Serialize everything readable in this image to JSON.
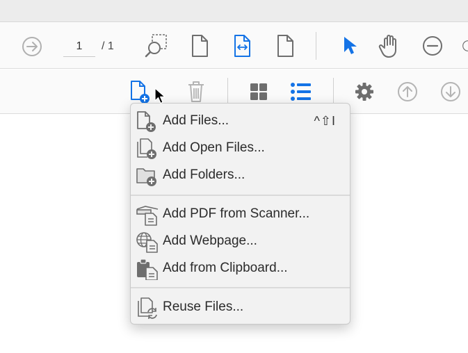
{
  "toolbar_top": {
    "page_current": "1",
    "page_total": "/ 1",
    "icons": [
      "next-page-icon",
      "marquee-zoom-icon",
      "single-page-icon",
      "fit-width-icon",
      "page-icon",
      "select-pointer-icon",
      "hand-icon",
      "zoom-out-icon",
      "zoom-in-icon"
    ]
  },
  "toolbar_secondary": {
    "icons": [
      "add-files-icon",
      "delete-icon",
      "grid-view-icon",
      "list-view-icon",
      "settings-icon",
      "move-up-icon",
      "move-down-icon"
    ]
  },
  "menu": {
    "items": [
      {
        "label": "Add Files...",
        "shortcut": "^⇧I",
        "icon": "add-file-icon"
      },
      {
        "label": "Add Open Files...",
        "icon": "add-open-files-icon"
      },
      {
        "label": "Add Folders...",
        "icon": "add-folder-icon"
      },
      {
        "label": "Add PDF from Scanner...",
        "icon": "scanner-icon"
      },
      {
        "label": "Add Webpage...",
        "icon": "webpage-icon"
      },
      {
        "label": "Add from Clipboard...",
        "icon": "clipboard-icon"
      },
      {
        "label": "Reuse Files...",
        "icon": "reuse-files-icon"
      }
    ]
  },
  "colors": {
    "accent": "#1473e6",
    "icon_gray": "#6e6e6e",
    "icon_disabled": "#b4b4b4"
  }
}
